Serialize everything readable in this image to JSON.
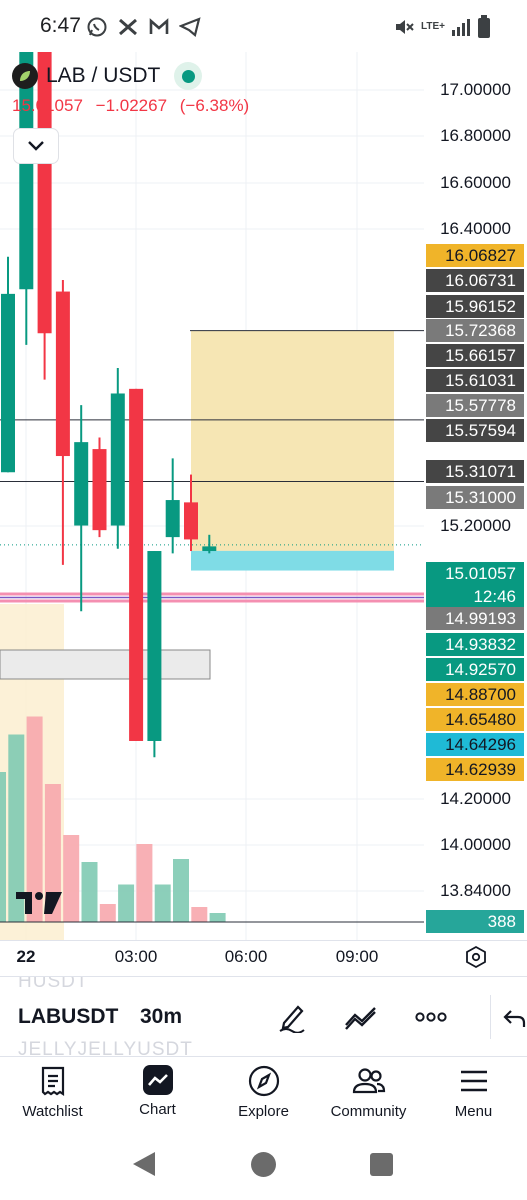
{
  "status_bar": {
    "time": "6:47",
    "left_icons": [
      "whatsapp-icon",
      "x-icon",
      "gmail-icon",
      "telegram-icon"
    ],
    "network": "LTE+",
    "right_icons": [
      "mute-icon",
      "lte-icon",
      "signal-icon",
      "battery-icon"
    ]
  },
  "symbol": {
    "name": "LAB / USDT",
    "last_price": "15.01057",
    "change": "−1.02267",
    "change_percent": "(−6.38%)",
    "market_status": "open"
  },
  "price_axis": {
    "ticks": [
      "17.00000",
      "16.80000",
      "16.60000",
      "16.40000",
      "15.20000",
      "14.20000",
      "14.00000",
      "13.84000"
    ],
    "labels": [
      {
        "text": "16.06827",
        "color": "#f0b429",
        "text_color": "#131722"
      },
      {
        "text": "16.06731",
        "color": "#454545",
        "text_color": "#ffffff"
      },
      {
        "text": "15.96152",
        "color": "#454545",
        "text_color": "#ffffff"
      },
      {
        "text": "15.72368",
        "color": "#7a7a7a",
        "text_color": "#ffffff"
      },
      {
        "text": "15.66157",
        "color": "#454545",
        "text_color": "#ffffff"
      },
      {
        "text": "15.61031",
        "color": "#454545",
        "text_color": "#ffffff"
      },
      {
        "text": "15.57778",
        "color": "#7a7a7a",
        "text_color": "#ffffff"
      },
      {
        "text": "15.57594",
        "color": "#454545",
        "text_color": "#ffffff"
      },
      {
        "text": "15.31071",
        "color": "#454545",
        "text_color": "#ffffff"
      },
      {
        "text": "15.31000",
        "color": "#7a7a7a",
        "text_color": "#ffffff"
      },
      {
        "text": "15.01057",
        "sub": "12:46",
        "color": "#089981",
        "text_color": "#ffffff"
      },
      {
        "text": "14.99193",
        "color": "#7a7a7a",
        "text_color": "#ffffff"
      },
      {
        "text": "14.93832",
        "color": "#089981",
        "text_color": "#ffffff"
      },
      {
        "text": "14.92570",
        "color": "#089981",
        "text_color": "#ffffff"
      },
      {
        "text": "14.88700",
        "color": "#f0b429",
        "text_color": "#131722"
      },
      {
        "text": "14.65480",
        "color": "#f0b429",
        "text_color": "#131722"
      },
      {
        "text": "14.64296",
        "color": "#1fbad6",
        "text_color": "#131722"
      },
      {
        "text": "14.62939",
        "color": "#f0b429",
        "text_color": "#131722"
      },
      {
        "text": "388",
        "color": "#26a69a",
        "text_color": "#ffffff"
      }
    ]
  },
  "time_axis": {
    "ticks": [
      "22",
      "03:00",
      "06:00",
      "09:00"
    ]
  },
  "chart_data": {
    "type": "candlestick",
    "interval": "30m",
    "candles": [
      {
        "o": 15.35,
        "h": 16.28,
        "l": 15.35,
        "c": 16.12,
        "dir": "up"
      },
      {
        "o": 16.14,
        "h": 17.22,
        "l": 15.9,
        "c": 17.2,
        "dir": "up"
      },
      {
        "o": 17.22,
        "h": 17.22,
        "l": 15.75,
        "c": 15.95,
        "dir": "down"
      },
      {
        "o": 16.13,
        "h": 16.18,
        "l": 14.95,
        "c": 15.42,
        "dir": "down"
      },
      {
        "o": 15.12,
        "h": 15.64,
        "l": 14.75,
        "c": 15.48,
        "dir": "up"
      },
      {
        "o": 15.45,
        "h": 15.5,
        "l": 15.07,
        "c": 15.1,
        "dir": "down"
      },
      {
        "o": 15.12,
        "h": 15.8,
        "l": 15.02,
        "c": 15.69,
        "dir": "up"
      },
      {
        "o": 15.71,
        "h": 15.71,
        "l": 14.19,
        "c": 14.19,
        "dir": "down"
      },
      {
        "o": 14.19,
        "h": 15.01,
        "l": 14.12,
        "c": 15.01,
        "dir": "up"
      },
      {
        "o": 15.07,
        "h": 15.41,
        "l": 15.0,
        "c": 15.23,
        "dir": "up"
      },
      {
        "o": 15.22,
        "h": 15.34,
        "l": 15.01,
        "c": 15.06,
        "dir": "down"
      },
      {
        "o": 15.03,
        "h": 15.08,
        "l": 15.0,
        "c": 15.01,
        "dir": "up"
      }
    ],
    "volume": [
      {
        "v": 1.0,
        "dir": "up"
      },
      {
        "v": 1.25,
        "dir": "up"
      },
      {
        "v": 1.37,
        "dir": "down"
      },
      {
        "v": 0.92,
        "dir": "down"
      },
      {
        "v": 0.58,
        "dir": "down"
      },
      {
        "v": 0.4,
        "dir": "up"
      },
      {
        "v": 0.12,
        "dir": "down"
      },
      {
        "v": 0.25,
        "dir": "up"
      },
      {
        "v": 0.52,
        "dir": "down"
      },
      {
        "v": 0.25,
        "dir": "up"
      },
      {
        "v": 0.42,
        "dir": "up"
      },
      {
        "v": 0.1,
        "dir": "down"
      },
      {
        "v": 0.06,
        "dir": "up"
      }
    ],
    "horizontal_lines": [
      15.96152,
      15.57594,
      15.31
    ],
    "position_zones": [
      {
        "top": 15.96152,
        "bottom": 15.01057,
        "color": "#f6e6b4"
      },
      {
        "top": 15.01057,
        "bottom": 14.9257,
        "color": "#7fdce6"
      }
    ],
    "volume_axis_value": "388",
    "countdown": "12:46"
  },
  "toolbar": {
    "ghost_above": "HUSDT",
    "symbol": "LABUSDT",
    "interval": "30m",
    "ghost_below": "JELLYJELLYUSDT",
    "icons": [
      "draw-pen-icon",
      "trend-line-icon",
      "more-icon",
      "undo-icon"
    ]
  },
  "bottom_nav": {
    "items": [
      {
        "label": "Watchlist",
        "icon": "watchlist-icon"
      },
      {
        "label": "Chart",
        "icon": "chart-icon"
      },
      {
        "label": "Explore",
        "icon": "compass-icon"
      },
      {
        "label": "Community",
        "icon": "community-icon"
      },
      {
        "label": "Menu",
        "icon": "hamburger-icon"
      }
    ]
  }
}
